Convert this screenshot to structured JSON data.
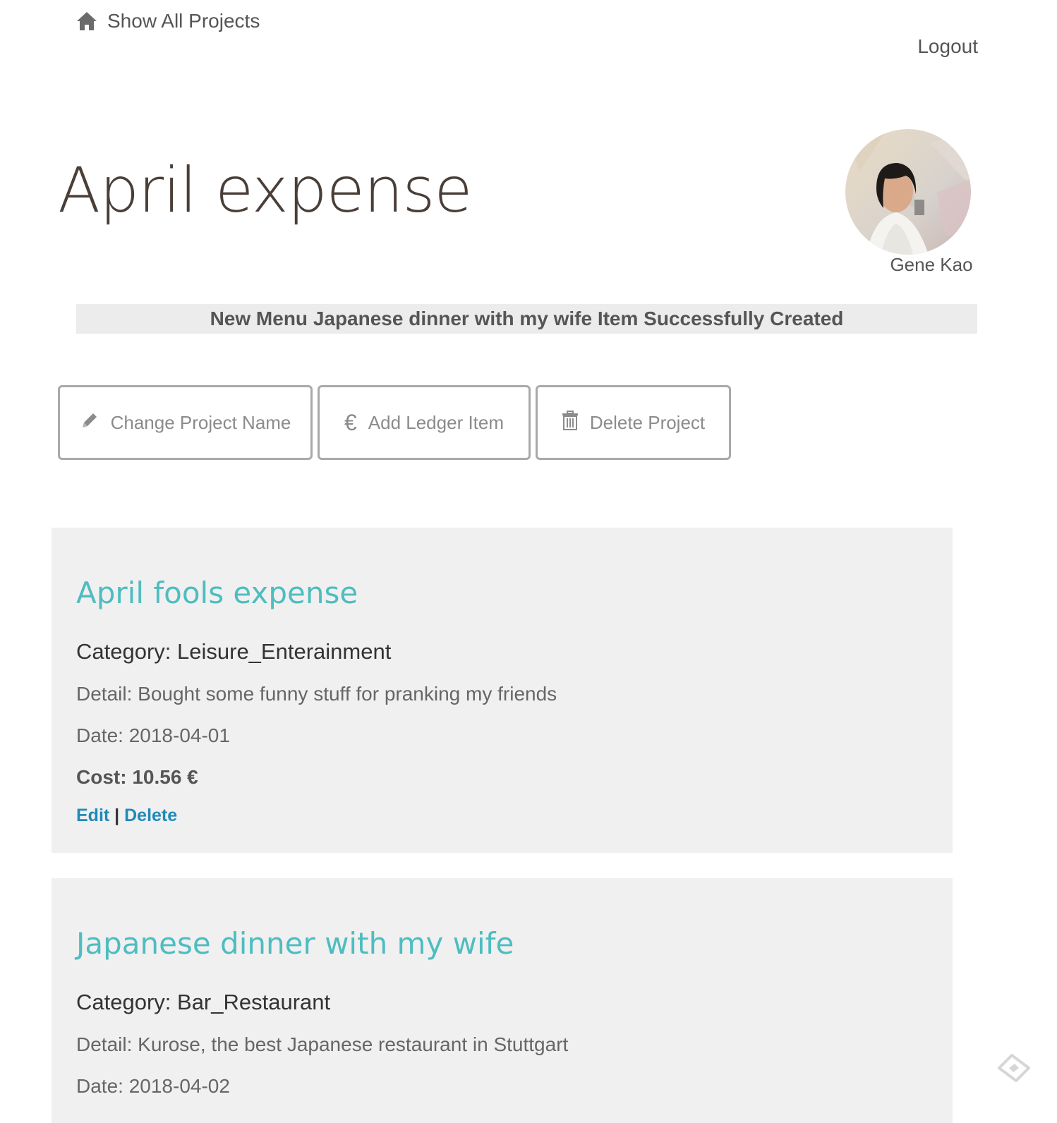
{
  "nav": {
    "home_label": "Show All Projects",
    "home_icon": "home-icon",
    "logout_label": "Logout"
  },
  "project": {
    "title": "April expense"
  },
  "user": {
    "name": "Gene Kao"
  },
  "flash": {
    "message": "New Menu Japanese dinner with my wife Item Successfully Created"
  },
  "actions": {
    "change_name": {
      "label": "Change Project Name",
      "icon": "pencil-icon"
    },
    "add_item": {
      "label": "Add Ledger Item",
      "icon": "euro-icon",
      "glyph": "€"
    },
    "delete_project": {
      "label": "Delete Project",
      "icon": "trash-icon"
    }
  },
  "ledger_items": [
    {
      "title": "April fools expense",
      "category": "Category: Leisure_Enterainment",
      "detail": "Detail: Bought some funny stuff for pranking my friends",
      "date": "Date: 2018-04-01",
      "cost": "Cost: 10.56 €",
      "edit_label": "Edit",
      "separator": "|",
      "delete_label": "Delete"
    },
    {
      "title": "Japanese dinner with my wife",
      "category": "Category: Bar_Restaurant",
      "detail": "Detail: Kurose, the best Japanese restaurant in Stuttgart",
      "date": "Date: 2018-04-02"
    }
  ],
  "colors": {
    "accent_title": "#4ebdc0",
    "link": "#1f8ab8",
    "card_bg": "#f0f0f0",
    "flash_bg": "#ececec"
  }
}
